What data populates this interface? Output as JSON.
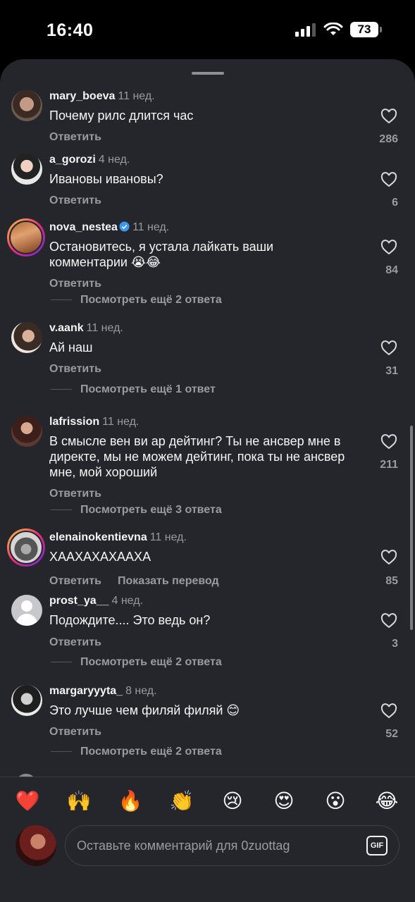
{
  "status_bar": {
    "time": "16:40",
    "battery": "73"
  },
  "comments": [
    {
      "username": "mary_boeva",
      "ago": "11 нед.",
      "text": "Почему рилс длится час",
      "reply": "Ответить",
      "likes": "286"
    },
    {
      "username": "a_gorozi",
      "ago": "4 нед.",
      "text": "Ивановы ивановы?",
      "reply": "Ответить",
      "likes": "6"
    },
    {
      "username": "nova_nestea",
      "ago": "11 нед.",
      "text": "Остановитесь, я устала лайкать ваши комментарии 😭😂",
      "reply": "Ответить",
      "likes": "84",
      "more": "Посмотреть ещё 2 ответа"
    },
    {
      "username": "v.aank",
      "ago": "11 нед.",
      "text": "Ай наш",
      "reply": "Ответить",
      "likes": "31",
      "more": "Посмотреть ещё 1 ответ"
    },
    {
      "username": "lafrission",
      "ago": "11 нед.",
      "text": "В смысле вен ви ар дейтинг?  Ты не ансвер мне в директе, мы не можем дейтинг, пока ты не ансвер мне, мой хороший",
      "reply": "Ответить",
      "likes": "211",
      "more": "Посмотреть ещё 3 ответа"
    },
    {
      "username": "elenainokentievna",
      "ago": "11 нед.",
      "text": "ХААХАХАХААХА",
      "reply": "Ответить",
      "translate": "Показать перевод",
      "likes": "85"
    },
    {
      "username": "prost_ya__",
      "ago": "4 нед.",
      "text": "Подождите.... Это ведь он?",
      "reply": "Ответить",
      "likes": "3",
      "more": "Посмотреть ещё 2 ответа"
    },
    {
      "username": "margaryyyta_",
      "ago": "8 нед.",
      "text": "Это лучше чем филяй филяй 😊",
      "reply": "Ответить",
      "likes": "52",
      "more": "Посмотреть ещё 2 ответа"
    }
  ],
  "emoji_bar": [
    "❤️",
    "🙌",
    "🔥",
    "👏",
    "😢",
    "😍",
    "😮",
    "😂"
  ],
  "composer": {
    "placeholder": "Оставьте комментарий для 0zuottag",
    "gif_label": "GIF"
  },
  "colors": {
    "background": "#25262b",
    "text": "#f5f5f5",
    "muted": "#9a9aa0",
    "verified": "#3897f0"
  }
}
